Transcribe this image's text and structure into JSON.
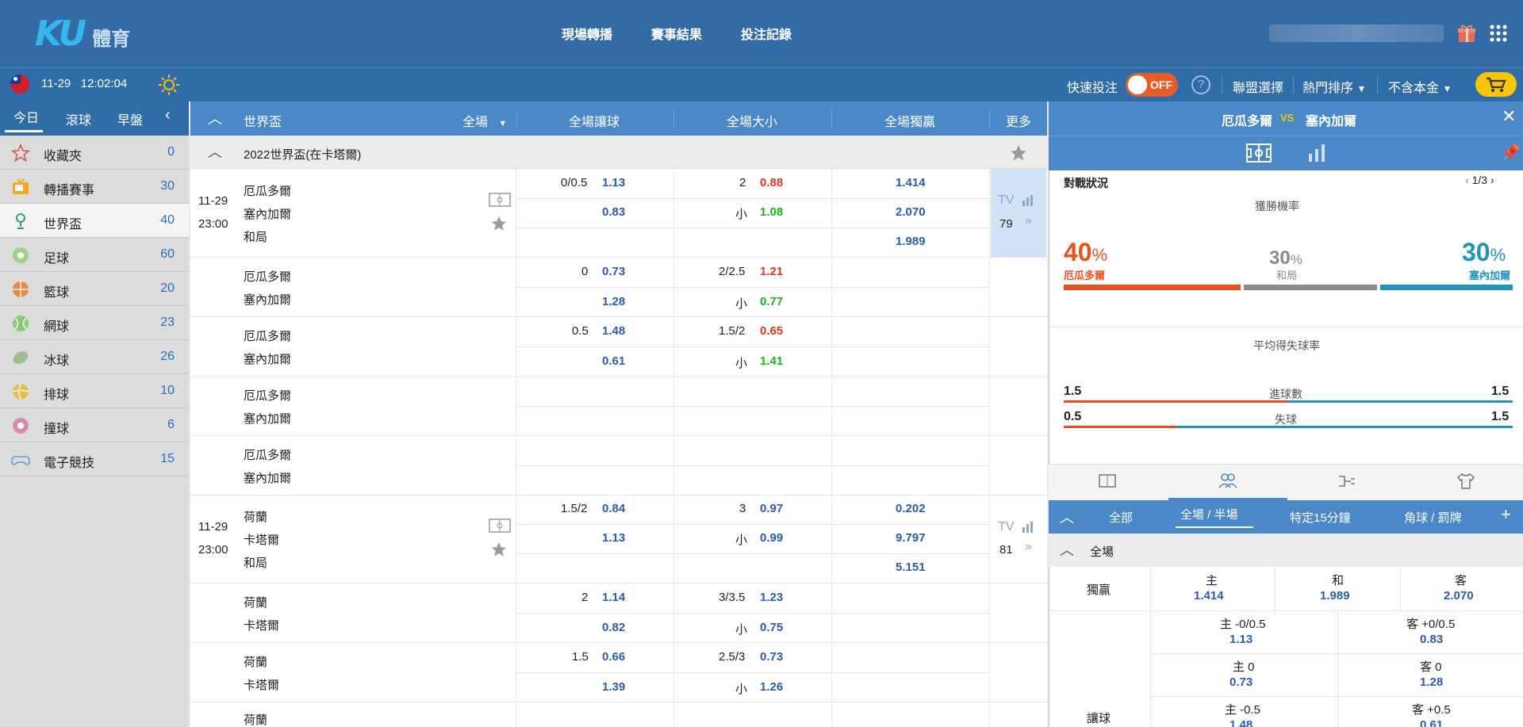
{
  "header": {
    "logo_ku": "KU",
    "logo_text": "體育",
    "nav": [
      "現場轉播",
      "賽事結果",
      "投注記錄"
    ]
  },
  "bar2": {
    "date": "11-29",
    "time": "12:02:04",
    "quick_bet": "快速投注",
    "toggle": "OFF",
    "help": "?",
    "league_select": "聯盟選擇",
    "hot_sort": "熱門排序",
    "principal": "不含本金"
  },
  "sidebar": {
    "tabs": [
      "今日",
      "滾球",
      "早盤"
    ],
    "items": [
      {
        "label": "收藏夾",
        "count": "0",
        "icon": "star-icon"
      },
      {
        "label": "轉播賽事",
        "count": "30",
        "icon": "tv-icon"
      },
      {
        "label": "世界盃",
        "count": "40",
        "icon": "trophy-icon"
      },
      {
        "label": "足球",
        "count": "60",
        "icon": "soccer-icon"
      },
      {
        "label": "籃球",
        "count": "20",
        "icon": "basketball-icon"
      },
      {
        "label": "網球",
        "count": "23",
        "icon": "tennis-icon"
      },
      {
        "label": "冰球",
        "count": "26",
        "icon": "hockey-icon"
      },
      {
        "label": "排球",
        "count": "10",
        "icon": "volleyball-icon"
      },
      {
        "label": "撞球",
        "count": "6",
        "icon": "billiards-icon"
      },
      {
        "label": "電子競技",
        "count": "15",
        "icon": "esports-icon"
      }
    ]
  },
  "main": {
    "header": {
      "title": "世界盃",
      "period": "全場",
      "handicap": "全場讓球",
      "overunder": "全場大小",
      "moneyline": "全場獨贏",
      "more": "更多"
    },
    "league": "2022世界盃(在卡塔爾)",
    "match1": {
      "date": "11-29",
      "time": "23:00",
      "home": "厄瓜多爾",
      "away": "塞內加爾",
      "draw": "和局",
      "tv": "TV",
      "more": "79",
      "rows": [
        {
          "hdp": "0/0.5",
          "hdp_h": "1.13",
          "hdp_a": "0.83",
          "ou": "2",
          "ou_o": "0.88",
          "ou_u_lbl": "小",
          "ou_u": "1.08",
          "ml_h": "1.414",
          "ml_a": "2.070",
          "ml_d": "1.989"
        },
        {
          "hdp": "0",
          "hdp_h": "0.73",
          "hdp_a": "1.28",
          "ou": "2/2.5",
          "ou_o": "1.21",
          "ou_u_lbl": "小",
          "ou_u": "0.77"
        },
        {
          "hdp": "0.5",
          "hdp_h": "1.48",
          "hdp_a": "0.61",
          "ou": "1.5/2",
          "ou_o": "0.65",
          "ou_u_lbl": "小",
          "ou_u": "1.41"
        }
      ]
    },
    "match2": {
      "date": "11-29",
      "time": "23:00",
      "home": "荷蘭",
      "away": "卡塔爾",
      "draw": "和局",
      "tv": "TV",
      "more": "81",
      "rows": [
        {
          "hdp": "1.5/2",
          "hdp_h": "0.84",
          "hdp_a": "1.13",
          "ou": "3",
          "ou_o": "0.97",
          "ou_u_lbl": "小",
          "ou_u": "0.99",
          "ml_h": "0.202",
          "ml_a": "9.797",
          "ml_d": "5.151"
        },
        {
          "hdp": "2",
          "hdp_h": "1.14",
          "hdp_a": "0.82",
          "ou": "3/3.5",
          "ou_o": "1.23",
          "ou_u_lbl": "小",
          "ou_u": "0.75"
        },
        {
          "hdp": "1.5",
          "hdp_h": "0.66",
          "hdp_a": "1.39",
          "ou": "2.5/3",
          "ou_o": "0.73",
          "ou_u_lbl": "小",
          "ou_u": "1.26"
        }
      ]
    },
    "extra_home": "荷蘭"
  },
  "right": {
    "home": "厄瓜多爾",
    "vs": "VS",
    "away": "塞內加爾",
    "stats_title": "對戰狀況",
    "page": "1/3",
    "win_prob": "獲勝機率",
    "home_pct": "40",
    "draw_pct": "30",
    "away_pct": "30",
    "pct_sign": "%",
    "draw_label": "和局",
    "avg_title": "平均得失球率",
    "goals_label": "進球數",
    "conceded_label": "失球",
    "goals_home": "1.5",
    "goals_away": "1.5",
    "conc_home": "0.5",
    "conc_away": "1.5",
    "subtabs": [
      "全部",
      "全場 / 半場",
      "特定15分鐘",
      "角球 / 罰牌"
    ],
    "plus": "+",
    "section": "全場",
    "moneyline_label": "獨贏",
    "home_lbl": "主",
    "draw_lbl": "和",
    "away_lbl": "客",
    "ml_h": "1.414",
    "ml_d": "1.989",
    "ml_a": "2.070",
    "hdp_label": "讓球",
    "hdp_rows": [
      {
        "h": "主 -0/0.5",
        "hv": "1.13",
        "a": "客 +0/0.5",
        "av": "0.83"
      },
      {
        "h": "主 0",
        "hv": "0.73",
        "a": "客 0",
        "av": "1.28"
      },
      {
        "h": "主 -0.5",
        "hv": "1.48",
        "a": "客 +0.5",
        "av": "0.61"
      }
    ]
  },
  "colors": {
    "primary": "#346ba5",
    "accent_orange": "#e8511e",
    "accent_teal": "#1d93b8",
    "odds_blue": "#2a5da8",
    "odds_red": "#e3341f",
    "odds_green": "#18b318",
    "cart": "#f7c600"
  }
}
